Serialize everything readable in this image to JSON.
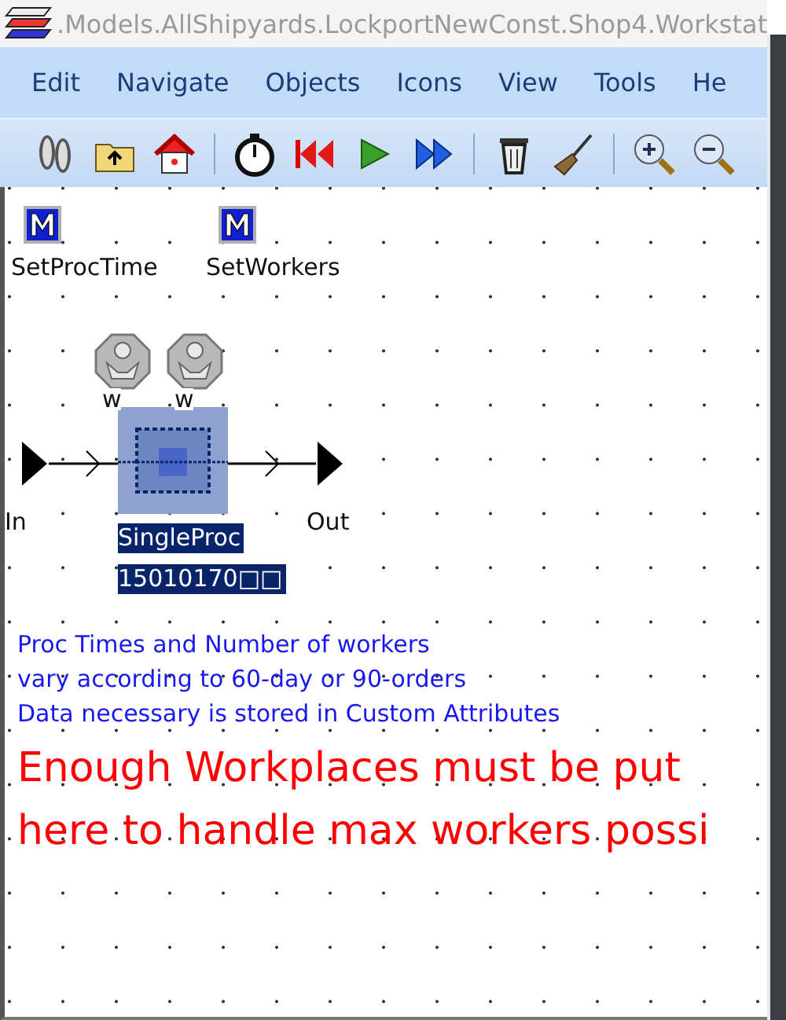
{
  "window": {
    "title": ".Models.AllShipyards.LockportNewConst.Shop4.Workstat"
  },
  "menu": [
    "Edit",
    "Navigate",
    "Objects",
    "Icons",
    "View",
    "Tools",
    "He"
  ],
  "canvas": {
    "methods": [
      {
        "label": "SetProcTime"
      },
      {
        "label": "SetWorkers"
      }
    ],
    "workers": [
      {
        "label": "w"
      },
      {
        "label": "w"
      }
    ],
    "source": {
      "label": "In"
    },
    "drain": {
      "label": "Out"
    },
    "station": {
      "label": "SingleProc",
      "value": "15010170□□",
      "selected": true
    },
    "notes": [
      {
        "kind": "note",
        "text": "Proc Times and Number of workers"
      },
      {
        "kind": "note",
        "text": "vary according to 60-day or 90-orders"
      },
      {
        "kind": "note",
        "text": "Data necessary is stored in Custom Attributes"
      },
      {
        "kind": "warning",
        "text": "Enough Workplaces must be put"
      },
      {
        "kind": "warning",
        "text": "here to handle max workers possi"
      }
    ]
  }
}
